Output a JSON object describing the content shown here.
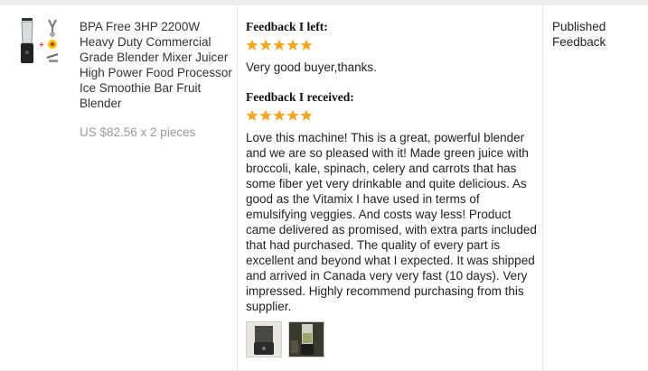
{
  "product": {
    "icon": "blender-icon",
    "title": "BPA Free 3HP 2200W Heavy Duty Commercial Grade Blender Mixer Juicer High Power Food Processor Ice Smoothie Bar Fruit Blender",
    "price": "US $82.56 x 2 pieces"
  },
  "feedback_left": {
    "heading": "Feedback I left:",
    "stars": 5,
    "text": "Very good buyer,thanks."
  },
  "feedback_received": {
    "heading": "Feedback I received:",
    "stars": 5,
    "text": "Love this machine! This is a great, powerful blender and we are so pleased with it! Made green juice with broccoli, kale, spinach, celery and carrots that has some fiber yet very drinkable and quite delicious. As good as the Vitamix I have used in terms of emulsifying veggies. And costs way less! Product came delivered as promised, with extra parts included that had purchased. The quality of every part is excellent and beyond what I expected. It was shipped and arrived in Canada very very fast (10 days). Very impressed. Highly recommend purchasing from this supplier.",
    "photos": [
      "photo-thumbnail-icon",
      "photo-thumbnail-icon"
    ]
  },
  "status": {
    "text": "Published Feedback"
  },
  "colors": {
    "star": "#f5a623",
    "price": "#999999"
  }
}
